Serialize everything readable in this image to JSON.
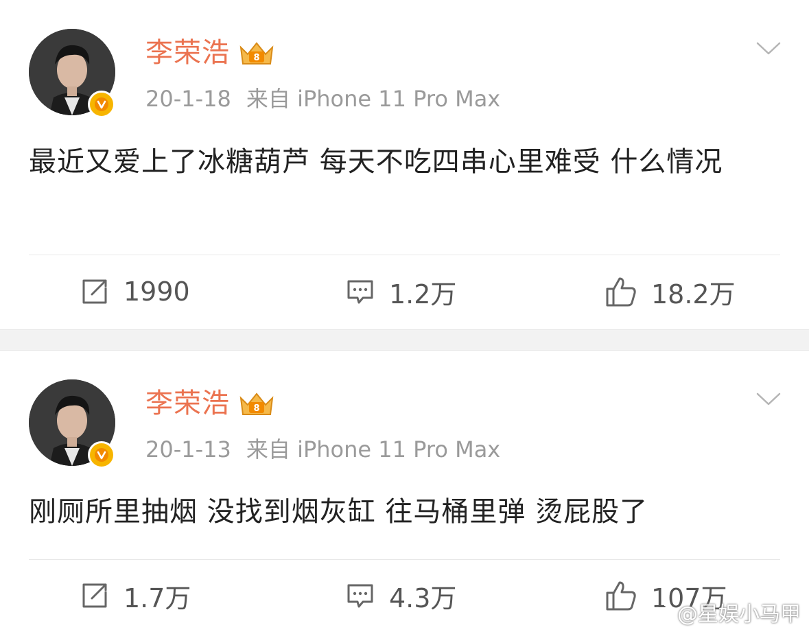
{
  "posts": [
    {
      "author": "李荣浩",
      "date": "20-1-18",
      "source": "来自 iPhone 11 Pro Max",
      "text": "最近又爱上了冰糖葫芦 每天不吃四串心里难受 什么情况",
      "reposts": "1990",
      "comments": "1.2万",
      "likes": "18.2万"
    },
    {
      "author": "李荣浩",
      "date": "20-1-13",
      "source": "来自 iPhone 11 Pro Max",
      "text": "刚厕所里抽烟 没找到烟灰缸 往马桶里弹 烫屁股了",
      "reposts": "1.7万",
      "comments": "4.3万",
      "likes": "107万"
    }
  ],
  "watermark": "@星娱小马甲",
  "colors": {
    "name": "#eb7350",
    "meta": "#9a9a9a",
    "text": "#222222",
    "badge": "#f7b500",
    "separator": "#f2f2f2"
  },
  "icons": [
    "repost-icon",
    "comment-icon",
    "like-icon",
    "chevron-down-icon",
    "verified-badge-icon",
    "vip-crown-icon",
    "weibo-logo-icon"
  ]
}
